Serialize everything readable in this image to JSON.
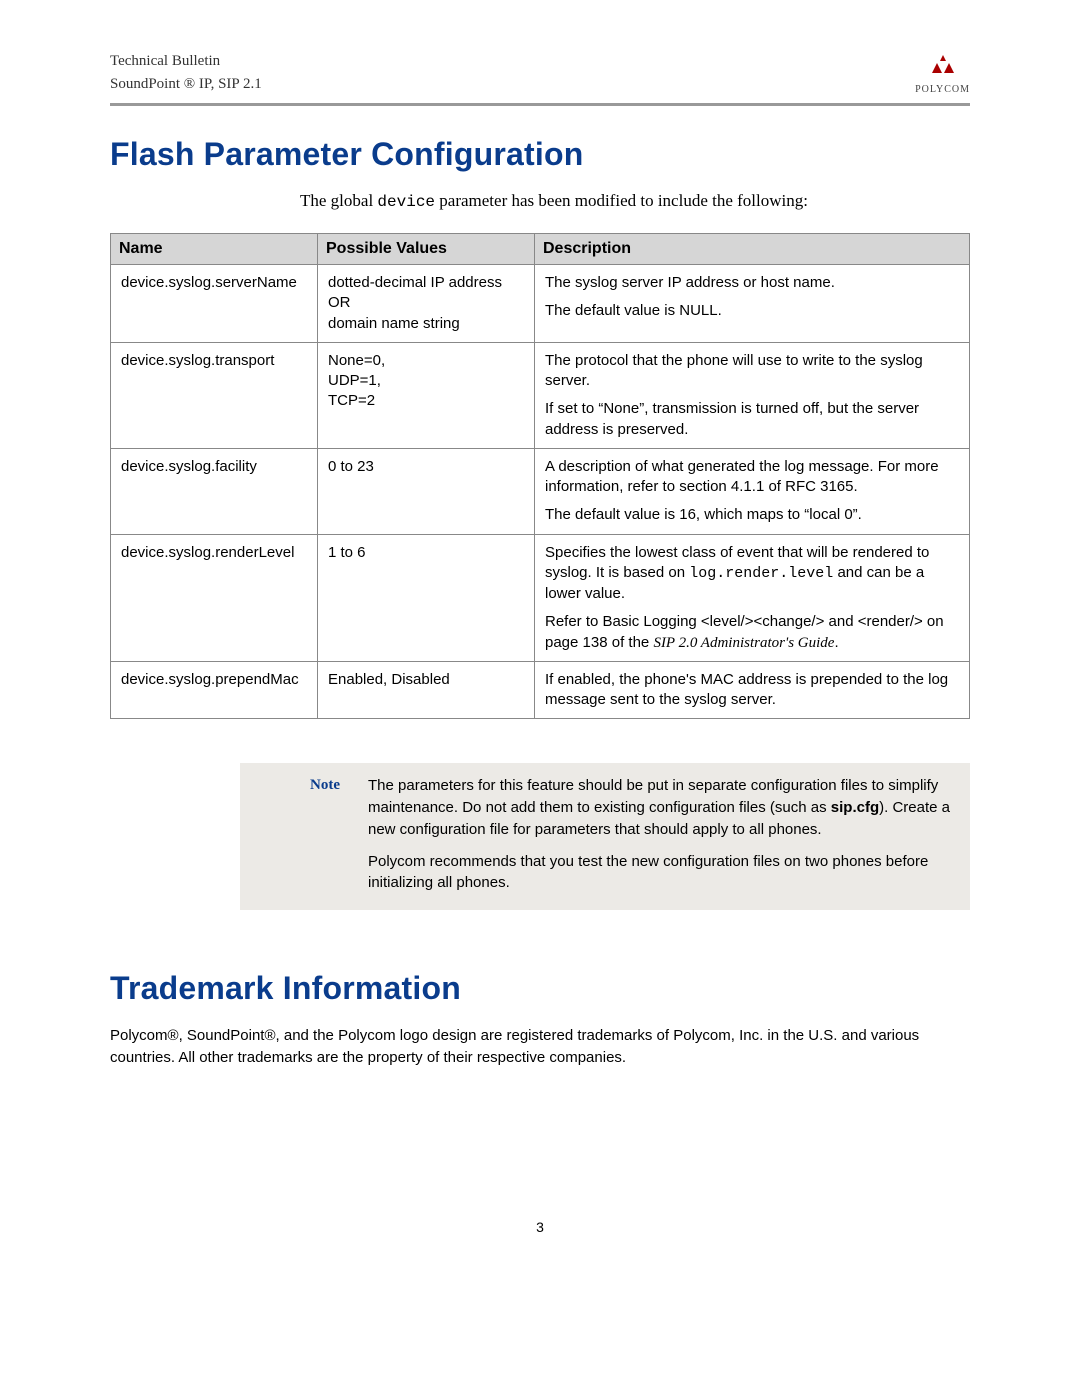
{
  "header": {
    "line1": "Technical Bulletin",
    "line2": "SoundPoint ® IP, SIP 2.1",
    "logo_text": "POLYCOM"
  },
  "section1": {
    "title": "Flash Parameter Configuration",
    "intro_pre": "The global ",
    "intro_code": "device",
    "intro_post": " parameter has been modified to include the following:"
  },
  "table": {
    "headers": {
      "name": "Name",
      "values": "Possible Values",
      "desc": "Description"
    },
    "rows": [
      {
        "name": "device.syslog.serverName",
        "values": "dotted-decimal IP address\nOR\ndomain name string",
        "desc_parts": [
          {
            "text": "The syslog server IP address or host name."
          },
          {
            "text": "The default value is NULL."
          }
        ]
      },
      {
        "name": "device.syslog.transport",
        "values": "None=0,\nUDP=1,\nTCP=2",
        "desc_parts": [
          {
            "text": "The protocol that the phone will use to write to the syslog server."
          },
          {
            "text": "If set to “None”, transmission is turned off, but the server address is preserved."
          }
        ]
      },
      {
        "name": "device.syslog.facility",
        "values": "0 to 23",
        "desc_parts": [
          {
            "text": "A description of what generated the log message. For more information, refer to section 4.1.1 of RFC 3165."
          },
          {
            "text": "The default value is 16, which maps to “local 0”."
          }
        ]
      },
      {
        "name": "device.syslog.renderLevel",
        "values": "1 to 6",
        "desc_parts": [
          {
            "rich": [
              {
                "t": "Specifies the lowest class of event that will be rendered to syslog. It is based on "
              },
              {
                "t": "log.render.level",
                "mono": true
              },
              {
                "t": " and can be a lower value."
              }
            ]
          },
          {
            "rich": [
              {
                "t": "Refer to Basic Logging <level/><change/> and <render/> on page 138 of the "
              },
              {
                "t": "SIP 2.0 Administrator's Guide",
                "italic": true
              },
              {
                "t": "."
              }
            ]
          }
        ]
      },
      {
        "name": "device.syslog.prependMac",
        "values": "Enabled, Disabled",
        "desc_parts": [
          {
            "text": "If enabled, the phone's MAC address is prepended to the log message sent to the syslog server."
          }
        ]
      }
    ]
  },
  "note": {
    "label": "Note",
    "para1_pre": "The parameters for this feature should be put in separate configuration files to simplify maintenance. Do not add them to existing configuration files (such as ",
    "para1_bold": "sip.cfg",
    "para1_post": "). Create a new configuration file for parameters that should apply to all phones.",
    "para2": "Polycom recommends that you test the new configuration files on two phones before initializing all phones."
  },
  "section2": {
    "title": "Trademark Information",
    "body": "Polycom®, SoundPoint®, and the Polycom logo design are registered trademarks of Polycom, Inc. in the U.S. and various countries. All other trademarks are the property of their respective companies."
  },
  "page_number": "3"
}
